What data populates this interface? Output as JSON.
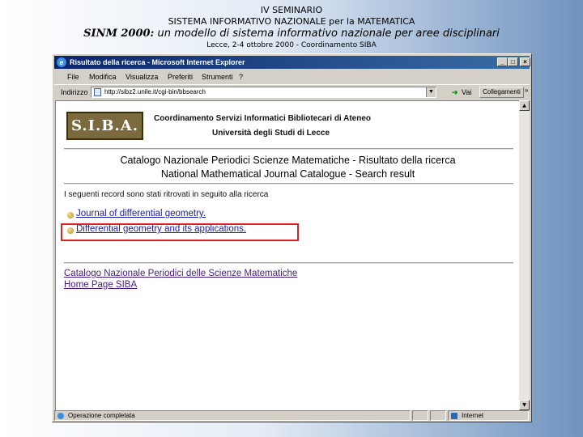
{
  "slide": {
    "line1": "IV SEMINARIO",
    "line2": "SISTEMA INFORMATIVO NAZIONALE per la MATEMATICA",
    "line3_bold": "SINM 2000:",
    "line3_rest": " un modello di sistema informativo nazionale per aree disciplinari",
    "line4": "Lecce, 2-4 ottobre 2000 - Coordinamento SIBA"
  },
  "window": {
    "title": "Risultato della ricerca - Microsoft Internet Explorer",
    "controls": {
      "minimize": "_",
      "maximize": "□",
      "close": "×"
    }
  },
  "menu": [
    "File",
    "Modifica",
    "Visualizza",
    "Preferiti",
    "Strumenti",
    "?"
  ],
  "address": {
    "label": "Indirizzo",
    "url": "http://sibz2.unile.it/cgi-bin/bbsearch",
    "go_label": "Vai",
    "links_label": "Collegamenti",
    "more": "»"
  },
  "page": {
    "logo_text": "S.I.B.A.",
    "org_line1": "Coordinamento Servizi Informatici Bibliotecari di Ateneo",
    "org_line2": "Università degli Studi di Lecce",
    "catalog_title_it": "Catalogo Nazionale Periodici Scienze Matematiche - Risultato della ricerca",
    "catalog_title_en": "National Mathematical Journal Catalogue - Search result",
    "intro": "I seguenti record sono stati ritrovati in seguito alla ricerca",
    "results": [
      "Journal of differential geometry.",
      "Differential geometry and its applications."
    ],
    "footer_links": [
      "Catalogo Nazionale Periodici delle Scienze Matematiche",
      "Home Page SIBA"
    ]
  },
  "status": {
    "text": "Operazione completata",
    "zone": "Internet"
  }
}
